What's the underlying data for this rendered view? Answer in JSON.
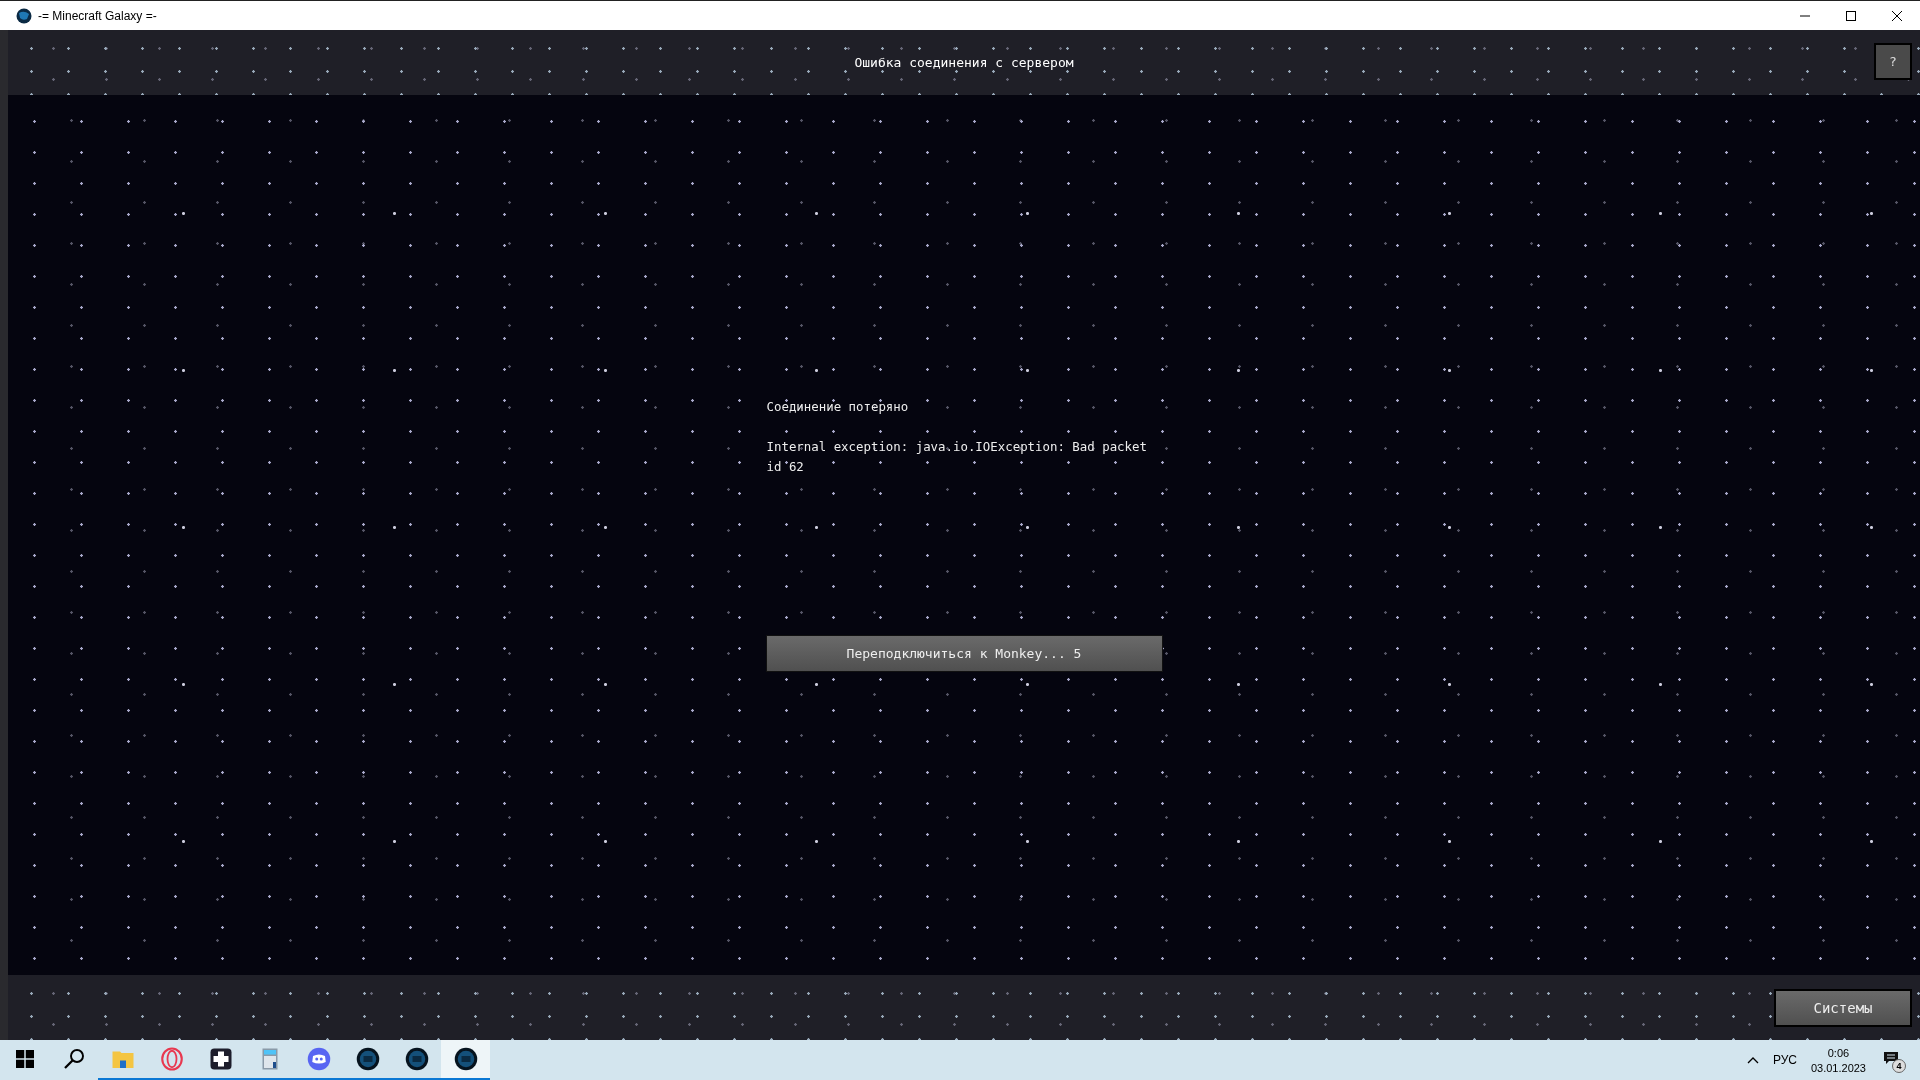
{
  "window": {
    "title": "-= Minecraft Galaxy =-"
  },
  "header": {
    "title": "Ошибка соединения с сервером",
    "help_button": "?"
  },
  "message": {
    "title": "Соединение потеряно",
    "detail": "Internal exception: java.io.IOException: Bad packet id 62"
  },
  "reconnect_button": "Переподключиться к Monkey... 5",
  "systems_button": "Системы",
  "taskbar": {
    "items": [
      {
        "kind": "start",
        "running": false,
        "selected": false
      },
      {
        "kind": "search",
        "running": false,
        "selected": false
      },
      {
        "kind": "folder",
        "running": true,
        "selected": false
      },
      {
        "kind": "browser",
        "running": true,
        "selected": false
      },
      {
        "kind": "app",
        "running": true,
        "selected": false
      },
      {
        "kind": "calculator",
        "running": true,
        "selected": false
      },
      {
        "kind": "chat",
        "running": true,
        "selected": false
      },
      {
        "kind": "globe",
        "running": true,
        "selected": false
      },
      {
        "kind": "globe",
        "running": true,
        "selected": false
      },
      {
        "kind": "globe",
        "running": true,
        "selected": true
      }
    ],
    "language": "РУС",
    "time": "0:06",
    "date": "03.01.2023",
    "notifications": "4"
  }
}
